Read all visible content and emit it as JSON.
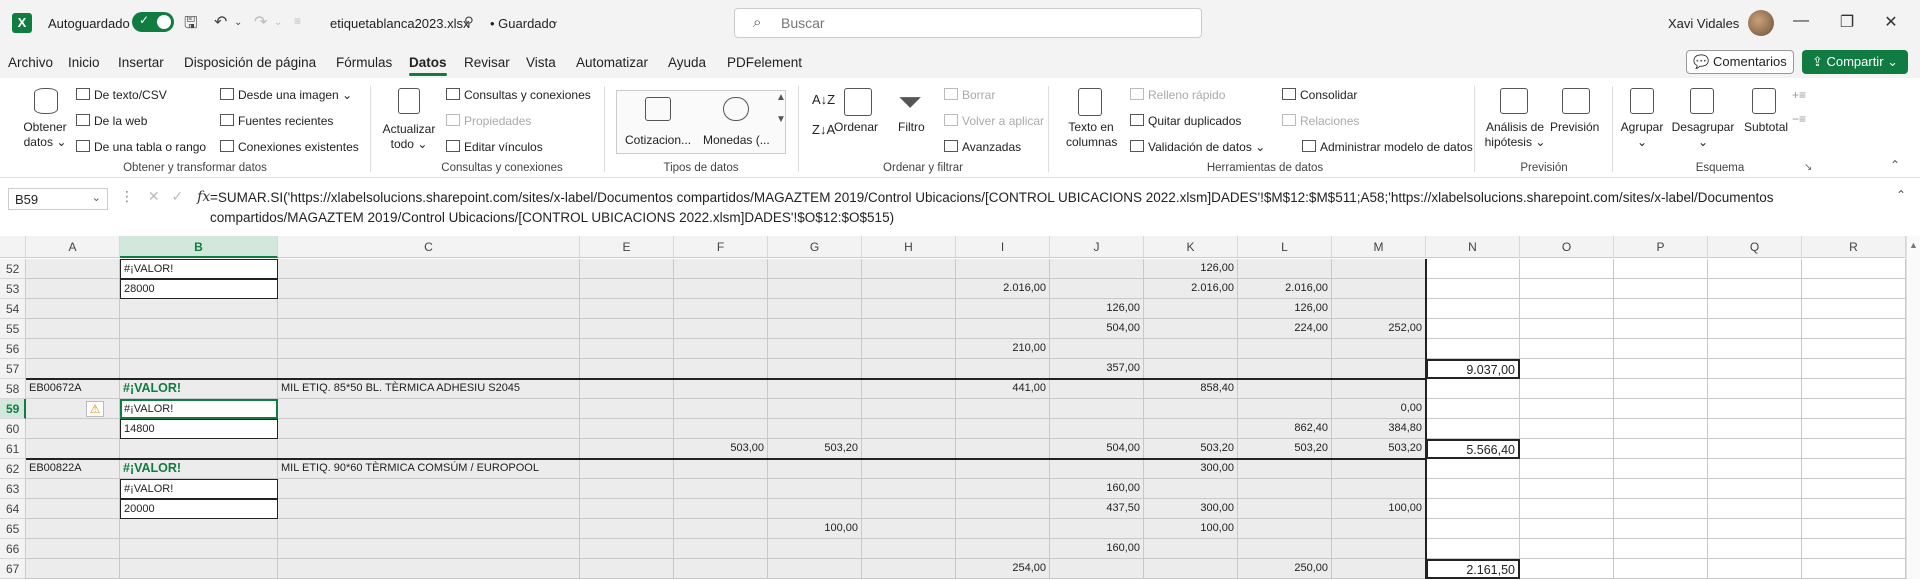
{
  "titlebar": {
    "autosave_label": "Autoguardado",
    "filename": "etiquetablanca2023.xlsx",
    "saved_status": "• Guardado",
    "search_placeholder": "Buscar",
    "user_name": "Xavi Vidales"
  },
  "menu": {
    "tabs": [
      "Archivo",
      "Inicio",
      "Insertar",
      "Disposición de página",
      "Fórmulas",
      "Datos",
      "Revisar",
      "Vista",
      "Automatizar",
      "Ayuda",
      "PDFelement"
    ],
    "active_tab": "Datos",
    "comments_label": "Comentarios",
    "share_label": "Compartir"
  },
  "ribbon": {
    "obtener_datos": "Obtener datos",
    "de_texto_csv": "De texto/CSV",
    "de_la_web": "De la web",
    "de_tabla": "De una tabla o rango",
    "desde_imagen": "Desde una imagen",
    "fuentes_recientes": "Fuentes recientes",
    "conexiones_existentes": "Conexiones existentes",
    "grp_obtener": "Obtener y transformar datos",
    "actualizar_todo": "Actualizar todo",
    "consultas_conexiones": "Consultas y conexiones",
    "propiedades": "Propiedades",
    "editar_vinculos": "Editar vínculos",
    "grp_consultas": "Consultas y conexiones",
    "cotizacion": "Cotizacion...",
    "monedas": "Monedas (...",
    "grp_tipos": "Tipos de datos",
    "ordenar": "Ordenar",
    "filtro": "Filtro",
    "borrar": "Borrar",
    "volver_aplicar": "Volver a aplicar",
    "avanzadas": "Avanzadas",
    "grp_ordenar": "Ordenar y filtrar",
    "texto_columnas": "Texto en columnas",
    "relleno_rapido": "Relleno rápido",
    "quitar_duplicados": "Quitar duplicados",
    "validacion": "Validación de datos",
    "consolidar": "Consolidar",
    "relaciones": "Relaciones",
    "admin_modelo": "Administrar modelo de datos",
    "grp_herramientas": "Herramientas de datos",
    "analisis": "Análisis de hipótesis",
    "prevision": "Previsión",
    "grp_prevision": "Previsión",
    "agrupar": "Agrupar",
    "desagrupar": "Desagrupar",
    "subtotal": "Subtotal",
    "grp_esquema": "Esquema"
  },
  "formula_bar": {
    "name_box": "B59",
    "fx": "fx",
    "formula_line1": "=SUMAR.SI('https://xlabelsolucions.sharepoint.com/sites/x-label/Documentos compartidos/MAGAZTEM 2019/Control Ubicacions/[CONTROL UBICACIONS 2022.xlsm]DADES'!$M$12:$M$511;A58;'https://xlabelsolucions.sharepoint.com/sites/x-label/Documentos",
    "formula_line2": "compartidos/MAGAZTEM 2019/Control Ubicacions/[CONTROL UBICACIONS 2022.xlsm]DADES'!$O$12:$O$515)"
  },
  "grid": {
    "columns": [
      "A",
      "B",
      "C",
      "E",
      "F",
      "G",
      "H",
      "I",
      "J",
      "K",
      "L",
      "M",
      "N",
      "O",
      "P",
      "Q",
      "R"
    ],
    "selected_column": "B",
    "selected_row": "59",
    "rows": [
      {
        "n": "52",
        "A": "",
        "B": "#¡VALOR!",
        "C": "",
        "E": "",
        "F": "",
        "G": "",
        "H": "",
        "I": "",
        "J": "",
        "K": "126,00",
        "L": "",
        "M": "",
        "N": ""
      },
      {
        "n": "53",
        "A": "",
        "B": "28000",
        "C": "",
        "E": "",
        "F": "",
        "G": "",
        "H": "",
        "I": "2.016,00",
        "J": "",
        "K": "2.016,00",
        "L": "2.016,00",
        "M": "",
        "N": ""
      },
      {
        "n": "54",
        "A": "",
        "B": "",
        "C": "",
        "E": "",
        "F": "",
        "G": "",
        "H": "",
        "I": "",
        "J": "126,00",
        "K": "",
        "L": "126,00",
        "M": "",
        "N": ""
      },
      {
        "n": "55",
        "A": "",
        "B": "",
        "C": "",
        "E": "",
        "F": "",
        "G": "",
        "H": "",
        "I": "",
        "J": "504,00",
        "K": "",
        "L": "224,00",
        "M": "252,00",
        "N": ""
      },
      {
        "n": "56",
        "A": "",
        "B": "",
        "C": "",
        "E": "",
        "F": "",
        "G": "",
        "H": "",
        "I": "210,00",
        "J": "",
        "K": "",
        "L": "",
        "M": "",
        "N": ""
      },
      {
        "n": "57",
        "A": "",
        "B": "",
        "C": "",
        "E": "",
        "F": "",
        "G": "",
        "H": "",
        "I": "",
        "J": "357,00",
        "K": "",
        "L": "",
        "M": "",
        "N": "9.037,00"
      },
      {
        "n": "58",
        "A": "EB00672A",
        "B": "#¡VALOR!",
        "C": "MIL ETIQ. 85*50 BL. TÈRMICA ADHESIU S2045",
        "E": "",
        "F": "",
        "G": "",
        "H": "",
        "I": "441,00",
        "J": "",
        "K": "858,40",
        "L": "",
        "M": "",
        "N": ""
      },
      {
        "n": "59",
        "A": "",
        "B": "#¡VALOR!",
        "C": "",
        "E": "",
        "F": "",
        "G": "",
        "H": "",
        "I": "",
        "J": "",
        "K": "",
        "L": "",
        "M": "0,00",
        "N": ""
      },
      {
        "n": "60",
        "A": "",
        "B": "14800",
        "C": "",
        "E": "",
        "F": "",
        "G": "",
        "H": "",
        "I": "",
        "J": "",
        "K": "",
        "L": "862,40",
        "M": "384,80",
        "N": ""
      },
      {
        "n": "61",
        "A": "",
        "B": "",
        "C": "",
        "E": "",
        "F": "503,00",
        "G": "503,20",
        "H": "",
        "I": "",
        "J": "504,00",
        "K": "503,20",
        "L": "503,20",
        "M": "503,20",
        "N": "5.566,40"
      },
      {
        "n": "62",
        "A": "EB00822A",
        "B": "#¡VALOR!",
        "C": "MIL ETIQ. 90*60 TÈRMICA COMSÚM / EUROPOOL",
        "E": "",
        "F": "",
        "G": "",
        "H": "",
        "I": "",
        "J": "",
        "K": "300,00",
        "L": "",
        "M": "",
        "N": ""
      },
      {
        "n": "63",
        "A": "",
        "B": "#¡VALOR!",
        "C": "",
        "E": "",
        "F": "",
        "G": "",
        "H": "",
        "I": "",
        "J": "160,00",
        "K": "",
        "L": "",
        "M": "",
        "N": ""
      },
      {
        "n": "64",
        "A": "",
        "B": "20000",
        "C": "",
        "E": "",
        "F": "",
        "G": "",
        "H": "",
        "I": "",
        "J": "437,50",
        "K": "300,00",
        "L": "",
        "M": "100,00",
        "N": ""
      },
      {
        "n": "65",
        "A": "",
        "B": "",
        "C": "",
        "E": "",
        "F": "",
        "G": "100,00",
        "H": "",
        "I": "",
        "J": "",
        "K": "100,00",
        "L": "",
        "M": "",
        "N": ""
      },
      {
        "n": "66",
        "A": "",
        "B": "",
        "C": "",
        "E": "",
        "F": "",
        "G": "",
        "H": "",
        "I": "",
        "J": "160,00",
        "K": "",
        "L": "",
        "M": "",
        "N": ""
      },
      {
        "n": "67",
        "A": "",
        "B": "",
        "C": "",
        "E": "",
        "F": "",
        "G": "",
        "H": "",
        "I": "254,00",
        "J": "",
        "K": "",
        "L": "250,00",
        "M": "",
        "N": "2.161,50"
      }
    ]
  }
}
